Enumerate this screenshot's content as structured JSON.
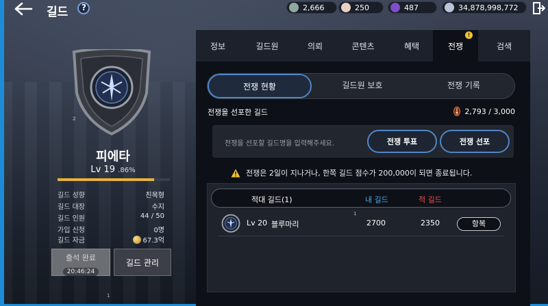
{
  "header": {
    "title": "길드"
  },
  "currencies": [
    {
      "name": "currency-1",
      "value": "2,666",
      "color": "#8fa8a0"
    },
    {
      "name": "currency-2",
      "value": "250",
      "color": "#e8d0c8"
    },
    {
      "name": "currency-3",
      "value": "487",
      "color": "#7a4fc8"
    },
    {
      "name": "currency-4",
      "value": "34,878,998,772",
      "color": "#b8c4d8"
    }
  ],
  "guild": {
    "emblem_num": "2",
    "name": "피에타",
    "level": "Lv 19",
    "xp_pct_label": ".86%",
    "xp_fraction": 0.86,
    "info": [
      {
        "label": "길드 성향",
        "value": "친목형"
      },
      {
        "label": "길드 대장",
        "value": "수지"
      },
      {
        "label": "길드 인원",
        "value": "44 / 50"
      },
      {
        "label": "가입 신청",
        "value": "0명"
      },
      {
        "label": "길드 자금",
        "value": "67.3억"
      }
    ],
    "attend_label": "출석 완료",
    "attend_timer": "20:46:24",
    "manage_label": "길드 관리",
    "footer_num": "1"
  },
  "tabs": [
    {
      "label": "정보",
      "active": false
    },
    {
      "label": "길드원",
      "active": false
    },
    {
      "label": "의뢰",
      "active": false
    },
    {
      "label": "콘텐츠",
      "active": false
    },
    {
      "label": "혜택",
      "active": false
    },
    {
      "label": "전쟁",
      "active": true,
      "alert": "!"
    },
    {
      "label": "검색",
      "active": false
    }
  ],
  "subtabs": [
    {
      "label": "전쟁 현황",
      "active": true
    },
    {
      "label": "길드원 보호",
      "active": false
    },
    {
      "label": "전쟁 기록",
      "active": false
    }
  ],
  "war": {
    "section_title": "전쟁을 선포한 길드",
    "count": "2,793 / 3,000",
    "input_placeholder": "전쟁을 선포할 길드명을 입력해주세요.",
    "vote_button": "전쟁 투표",
    "declare_button": "전쟁 선포",
    "notice": "전쟁은 2일이 지나거나, 한쪽 길드 점수가 200,000이 되면 종료됩니다.",
    "table": {
      "headers": {
        "enemy": "적대 길드(1)",
        "mine": "내 길드",
        "theirs": "적 길드"
      },
      "header_colors": {
        "mine": "#4aa8f0",
        "theirs": "#f05050"
      },
      "marker": "1",
      "rows": [
        {
          "level": "Lv 20",
          "name": "블루마리",
          "mine": "2700",
          "theirs": "2350",
          "action": "항복"
        }
      ]
    }
  }
}
